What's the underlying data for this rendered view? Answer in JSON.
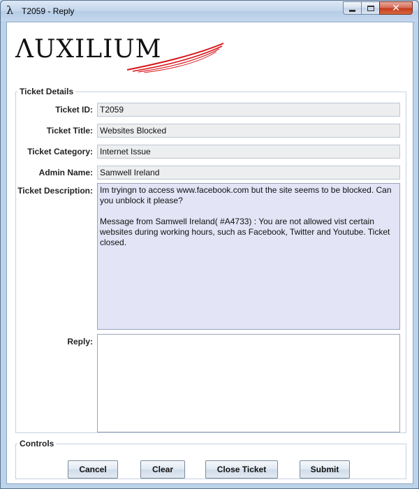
{
  "window": {
    "title": "T2059 - Reply",
    "app_icon_glyph": "λ"
  },
  "logo": {
    "text": "ΛUXILIUM"
  },
  "details": {
    "legend": "Ticket Details",
    "ticket_id_label": "Ticket ID:",
    "ticket_id_value": "T2059",
    "ticket_title_label": "Ticket Title:",
    "ticket_title_value": "Websites Blocked",
    "ticket_category_label": "Ticket Category:",
    "ticket_category_value": "Internet Issue",
    "admin_name_label": "Admin Name:",
    "admin_name_value": "Samwell Ireland",
    "description_label": "Ticket Description:",
    "description_lines": [
      "Im tryingn to access www.facebook.com but the site seems to be blocked. Can you unblock it please?",
      "Message from Samwell Ireland( #A4733) : You are not allowed vist certain websites during working hours, such as Facebook, Twitter and Youtube. Ticket closed."
    ],
    "reply_label": "Reply:",
    "reply_value": ""
  },
  "controls": {
    "legend": "Controls",
    "cancel_label": "Cancel",
    "clear_label": "Clear",
    "close_ticket_label": "Close Ticket",
    "submit_label": "Submit"
  },
  "colors": {
    "description_bg": "#e3e4f6",
    "logo_swoosh": "#d8141a",
    "field_bg": "#eceef0"
  }
}
